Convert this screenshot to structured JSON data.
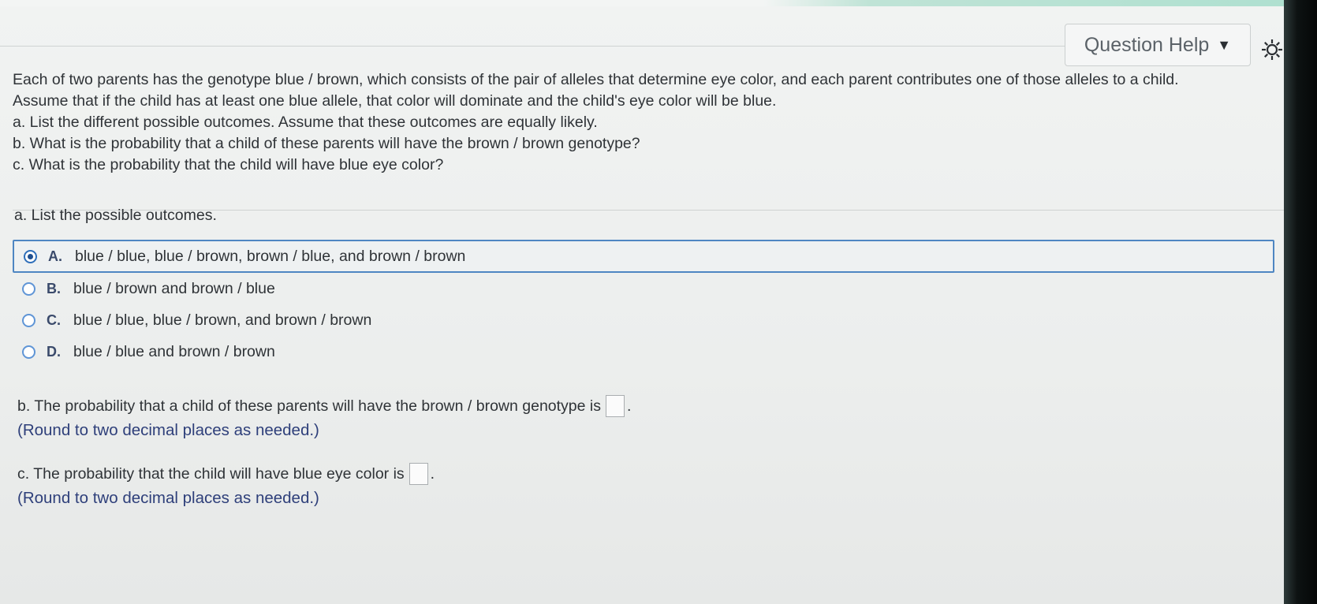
{
  "header": {
    "help_label": "Question Help",
    "help_icon": "caret-down-icon",
    "settings_icon": "gear-icon"
  },
  "question": {
    "lines": [
      "Each of two parents has the genotype blue / brown, which consists of the pair of alleles that determine eye color, and each parent contributes one of those alleles to a child.",
      "Assume that if the child has at least one blue allele, that color will dominate and the child's eye color will be blue.",
      "a. List the different possible outcomes. Assume that these outcomes are equally likely.",
      "b. What is the probability that a child of these parents will have the brown / brown genotype?",
      "c. What is the probability that the child will have blue eye color?"
    ]
  },
  "part_a": {
    "label": "a. List the possible outcomes.",
    "selected": "A",
    "options": [
      {
        "letter": "A.",
        "text": "blue / blue, blue / brown, brown / blue, and brown / brown"
      },
      {
        "letter": "B.",
        "text": "blue / brown and brown / blue"
      },
      {
        "letter": "C.",
        "text": "blue / blue, blue / brown, and brown / brown"
      },
      {
        "letter": "D.",
        "text": "blue / blue and brown / brown"
      }
    ]
  },
  "part_b": {
    "prompt": "b. The probability that a child of these parents will have the brown / brown genotype is",
    "answer": "",
    "suffix": ".",
    "hint": "(Round to two decimal places as needed.)"
  },
  "part_c": {
    "prompt": "c. The probability that the child will have blue eye color is",
    "answer": "",
    "suffix": ".",
    "hint": "(Round to two decimal places as needed.)"
  },
  "colors": {
    "selected_border": "#4e86c2",
    "radio": "#5f95d6",
    "hint_text": "#2e3f7a"
  }
}
